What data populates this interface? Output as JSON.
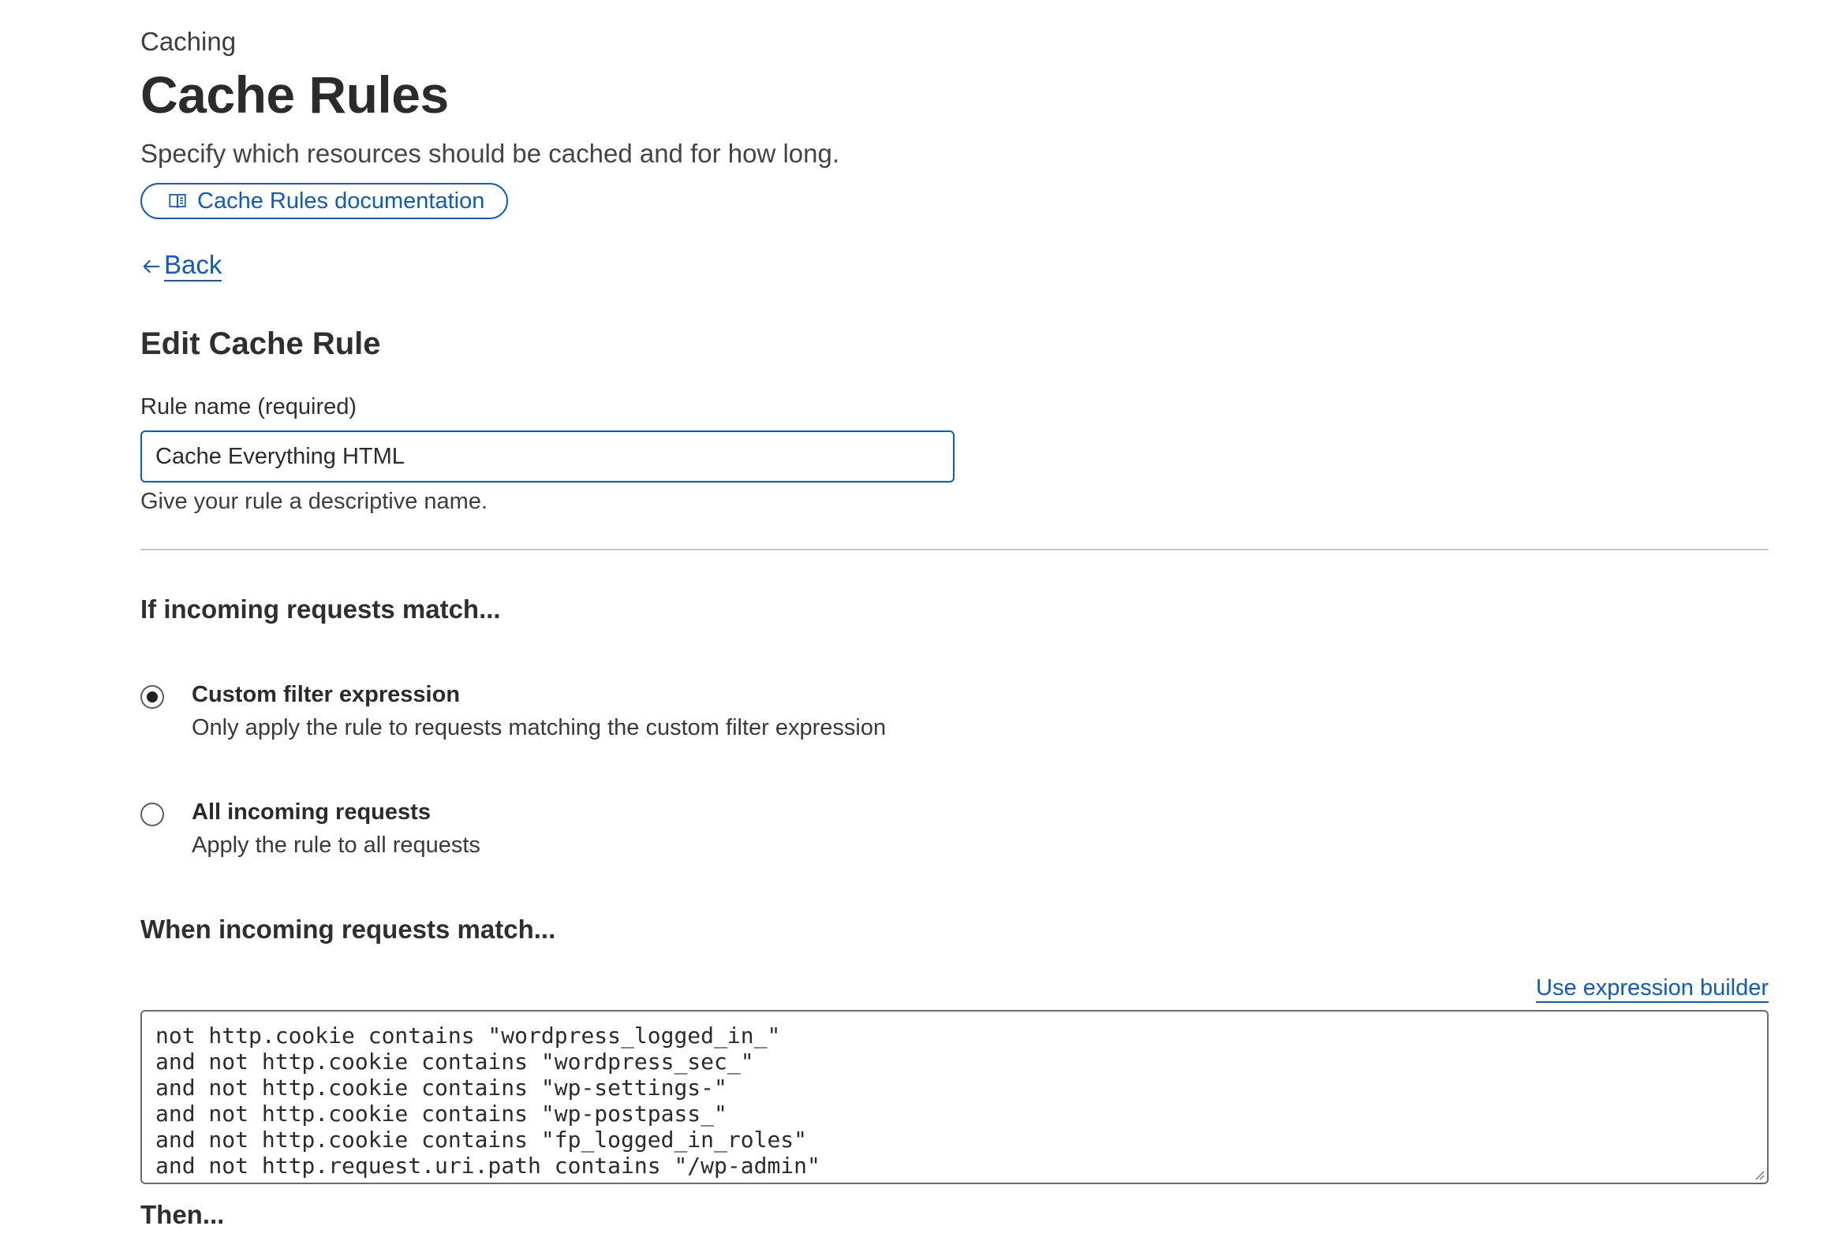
{
  "header": {
    "eyebrow": "Caching",
    "title": "Cache Rules",
    "subtitle": "Specify which resources should be cached and for how long.",
    "doc_button_label": "Cache Rules documentation",
    "doc_button_icon": "book-icon",
    "back_label": "Back",
    "back_icon": "arrow-left-icon"
  },
  "form": {
    "section_title": "Edit Cache Rule",
    "rule_name_label": "Rule name (required)",
    "rule_name_value": "Cache Everything HTML",
    "rule_name_helper": "Give your rule a descriptive name."
  },
  "match": {
    "title": "If incoming requests match...",
    "options": [
      {
        "title": "Custom filter expression",
        "description": "Only apply the rule to requests matching the custom filter expression",
        "selected": true
      },
      {
        "title": "All incoming requests",
        "description": "Apply the rule to all requests",
        "selected": false
      }
    ]
  },
  "expression": {
    "title": "When incoming requests match...",
    "builder_link": "Use expression builder",
    "lines": [
      "not http.cookie contains \"wordpress_logged_in_\"",
      "and not http.cookie contains \"wordpress_sec_\"",
      "and not http.cookie contains \"wp-settings-\"",
      "and not http.cookie contains \"wp-postpass_\"",
      "and not http.cookie contains \"fp_logged_in_roles\"",
      "and not http.request.uri.path contains \"/wp-admin\""
    ]
  },
  "then": {
    "title": "Then..."
  },
  "colors": {
    "accent": "#0d5ac8",
    "text": "#313131",
    "divider": "#c7c7c7"
  }
}
